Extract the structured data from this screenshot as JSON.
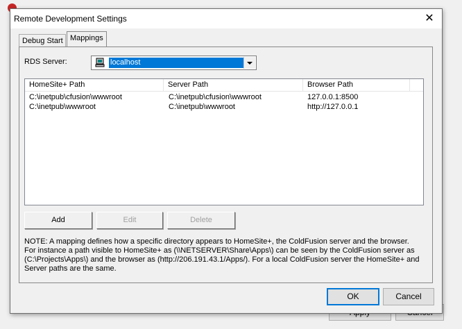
{
  "background_window": {
    "apply_label": "Apply",
    "cancel_label": "Cancel"
  },
  "dialog": {
    "title": "Remote Development Settings",
    "close_glyph": "✕"
  },
  "tabs": [
    {
      "label": "Debug Start",
      "active": false
    },
    {
      "label": "Mappings",
      "active": true
    }
  ],
  "rds": {
    "label": "RDS Server:",
    "selected": "localhost",
    "icon": "computer-icon"
  },
  "mappings": {
    "columns": [
      "HomeSite+ Path",
      "Server Path",
      "Browser Path"
    ],
    "rows": [
      [
        "C:\\inetpub\\cfusion\\wwwroot",
        "C:\\inetpub\\cfusion\\wwwroot",
        "127.0.0.1:8500"
      ],
      [
        "C:\\inetpub\\wwwroot",
        "C:\\inetpub\\wwwroot",
        "http://127.0.0.1"
      ]
    ]
  },
  "buttons": {
    "add": "Add",
    "edit": "Edit",
    "delete": "Delete",
    "ok": "OK",
    "cancel": "Cancel"
  },
  "note": "NOTE: A mapping defines how a specific directory appears to HomeSite+, the ColdFusion server and the browser. For instance  a path visible to HomeSite+ as (\\\\NETSERVER\\Share\\Apps\\) can be seen by the ColdFusion server as (C:\\Projects\\Apps\\)  and the browser as (http://206.191.43.1/Apps/). For a local ColdFusion server the HomeSite+ and Server paths are the same.",
  "colors": {
    "selection": "#0078d7",
    "disabled_text": "#a0a0a0"
  }
}
